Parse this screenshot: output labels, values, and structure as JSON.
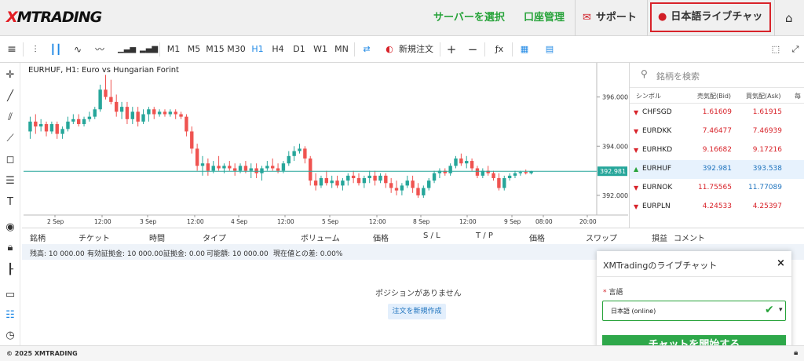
{
  "header": {
    "logo_prefix": "X",
    "logo_rest": "MTRADING",
    "nav_server": "サーバーを選択",
    "nav_account": "口座管理",
    "nav_support": "サポート",
    "nav_chat": "日本語ライブチャット",
    "icon_support": "envelope-icon",
    "icon_chat": "speech-bubble-icon",
    "icon_home": "home-icon",
    "accent": "#27a33a",
    "brand_red": "#d8232a"
  },
  "toolbar": {
    "timeframes": [
      "M1",
      "M5",
      "M15",
      "M30",
      "H1",
      "H4",
      "D1",
      "W1",
      "MN"
    ],
    "active_timeframe": "H1",
    "new_order": "新規注文"
  },
  "chart": {
    "title": "EURHUF, H1: Euro vs Hungarian Forint",
    "x_labels": [
      "2 Sep",
      "12:00",
      "3 Sep",
      "12:00",
      "4 Sep",
      "12:00",
      "5 Sep",
      "12:00",
      "8 Sep",
      "12:00",
      "9 Sep",
      "08:00",
      "20:00"
    ],
    "y_labels": [
      "396.000",
      "394.000",
      "392.000"
    ],
    "current_price": "392.981"
  },
  "chart_data": {
    "type": "candlestick",
    "symbol": "EURHUF",
    "timeframe": "H1",
    "ylim": [
      391.2,
      397.2
    ],
    "y_ticks": [
      396.0,
      394.0,
      392.0
    ],
    "current_price": 392.981,
    "up_color": "#26a69a",
    "down_color": "#ef5350",
    "series": [
      [
        394.6,
        395.2,
        394.3,
        395.0
      ],
      [
        395.0,
        395.3,
        394.5,
        394.8
      ],
      [
        394.8,
        395.1,
        394.6,
        394.9
      ],
      [
        394.9,
        395.0,
        394.4,
        394.6
      ],
      [
        394.6,
        395.0,
        394.5,
        394.9
      ],
      [
        394.9,
        395.0,
        394.3,
        394.5
      ],
      [
        394.5,
        394.8,
        394.3,
        394.7
      ],
      [
        394.7,
        395.2,
        394.6,
        395.0
      ],
      [
        395.0,
        395.3,
        394.9,
        395.1
      ],
      [
        395.1,
        395.3,
        394.8,
        394.9
      ],
      [
        394.9,
        395.2,
        394.8,
        395.1
      ],
      [
        395.1,
        395.4,
        395.0,
        395.2
      ],
      [
        395.2,
        395.6,
        395.1,
        395.5
      ],
      [
        395.5,
        396.5,
        395.4,
        396.3
      ],
      [
        396.3,
        396.9,
        395.9,
        396.0
      ],
      [
        396.0,
        396.7,
        395.7,
        395.8
      ],
      [
        395.8,
        396.1,
        395.2,
        395.4
      ],
      [
        395.4,
        395.8,
        395.1,
        395.6
      ],
      [
        395.6,
        395.8,
        394.9,
        395.1
      ],
      [
        395.1,
        395.6,
        394.9,
        395.4
      ],
      [
        395.4,
        395.6,
        394.8,
        395.0
      ],
      [
        395.0,
        395.5,
        394.9,
        395.3
      ],
      [
        395.3,
        395.6,
        395.0,
        395.5
      ],
      [
        395.5,
        395.6,
        395.1,
        395.3
      ],
      [
        395.3,
        395.5,
        395.2,
        395.4
      ],
      [
        395.4,
        395.5,
        395.2,
        395.3
      ],
      [
        395.3,
        395.5,
        395.2,
        395.4
      ],
      [
        395.4,
        395.5,
        395.1,
        395.3
      ],
      [
        395.3,
        395.4,
        395.1,
        395.2
      ],
      [
        395.2,
        395.3,
        394.4,
        394.6
      ],
      [
        394.6,
        394.8,
        393.7,
        393.9
      ],
      [
        393.9,
        394.1,
        393.0,
        393.2
      ],
      [
        393.2,
        393.6,
        392.8,
        393.3
      ],
      [
        393.3,
        393.5,
        392.8,
        393.0
      ],
      [
        393.0,
        393.4,
        392.9,
        393.2
      ],
      [
        393.2,
        393.6,
        393.0,
        393.1
      ],
      [
        393.1,
        393.3,
        392.9,
        393.2
      ],
      [
        393.2,
        393.4,
        393.0,
        393.1
      ],
      [
        393.1,
        393.3,
        392.8,
        393.0
      ],
      [
        393.0,
        393.3,
        392.9,
        393.2
      ],
      [
        393.2,
        393.4,
        392.9,
        393.0
      ],
      [
        393.0,
        393.3,
        392.7,
        393.1
      ],
      [
        393.1,
        393.3,
        392.7,
        392.9
      ],
      [
        392.9,
        393.2,
        392.6,
        393.1
      ],
      [
        393.1,
        393.4,
        393.0,
        393.2
      ],
      [
        393.2,
        393.5,
        393.0,
        393.1
      ],
      [
        393.1,
        393.3,
        392.9,
        393.0
      ],
      [
        393.0,
        393.4,
        392.9,
        393.3
      ],
      [
        393.3,
        393.8,
        393.2,
        393.6
      ],
      [
        393.6,
        394.0,
        393.4,
        393.8
      ],
      [
        393.8,
        394.1,
        393.7,
        393.9
      ],
      [
        393.9,
        394.0,
        393.3,
        393.5
      ],
      [
        393.5,
        393.6,
        392.4,
        392.6
      ],
      [
        392.6,
        392.9,
        392.2,
        392.4
      ],
      [
        392.4,
        392.8,
        392.3,
        392.7
      ],
      [
        392.7,
        393.0,
        392.4,
        392.5
      ],
      [
        392.5,
        392.8,
        392.3,
        392.6
      ],
      [
        392.6,
        392.8,
        392.3,
        392.4
      ],
      [
        392.4,
        392.7,
        392.2,
        392.6
      ],
      [
        392.6,
        392.9,
        392.4,
        392.8
      ],
      [
        392.8,
        393.0,
        392.5,
        392.7
      ],
      [
        392.7,
        392.9,
        392.4,
        392.5
      ],
      [
        392.5,
        392.8,
        392.3,
        392.7
      ],
      [
        392.7,
        393.0,
        392.5,
        392.8
      ],
      [
        392.8,
        393.0,
        392.4,
        392.6
      ],
      [
        392.6,
        392.9,
        392.5,
        392.8
      ],
      [
        392.8,
        392.9,
        392.3,
        392.5
      ],
      [
        392.5,
        392.7,
        392.1,
        392.3
      ],
      [
        392.3,
        392.6,
        392.0,
        392.2
      ],
      [
        392.2,
        392.5,
        392.0,
        392.4
      ],
      [
        392.4,
        392.8,
        392.3,
        392.6
      ],
      [
        392.6,
        392.8,
        392.1,
        392.3
      ],
      [
        392.3,
        392.5,
        391.9,
        392.0
      ],
      [
        392.0,
        392.4,
        391.9,
        392.3
      ],
      [
        392.3,
        392.7,
        392.2,
        392.6
      ],
      [
        392.6,
        393.0,
        392.5,
        392.9
      ],
      [
        392.9,
        393.1,
        392.7,
        393.0
      ],
      [
        393.0,
        393.1,
        392.8,
        392.9
      ],
      [
        392.9,
        393.3,
        392.8,
        393.2
      ],
      [
        393.2,
        393.6,
        393.1,
        393.5
      ],
      [
        393.5,
        393.7,
        393.2,
        393.3
      ],
      [
        393.3,
        393.6,
        393.1,
        393.4
      ],
      [
        393.4,
        393.5,
        393.0,
        393.1
      ],
      [
        393.1,
        393.2,
        392.7,
        392.8
      ],
      [
        392.8,
        393.1,
        392.7,
        393.0
      ],
      [
        393.0,
        393.2,
        392.8,
        392.9
      ],
      [
        392.9,
        393.0,
        392.6,
        392.7
      ],
      [
        392.7,
        392.9,
        392.2,
        392.3
      ],
      [
        392.3,
        392.8,
        392.2,
        392.7
      ],
      [
        392.7,
        392.9,
        392.6,
        392.8
      ],
      [
        392.8,
        393.0,
        392.7,
        392.9
      ],
      [
        392.9,
        393.0,
        392.8,
        392.95
      ],
      [
        392.95,
        393.05,
        392.85,
        392.9
      ],
      [
        392.9,
        393.0,
        392.85,
        392.981
      ]
    ]
  },
  "watchlist": {
    "search_placeholder": "銘柄を検索",
    "col_symbol": "シンボル",
    "col_bid": "売気配(Bid)",
    "col_ask": "買気配(Ask)",
    "col_extra": "毎",
    "rows": [
      {
        "symbol": "CHFSGD",
        "bid": "1.61609",
        "ask": "1.61915",
        "dir": "down"
      },
      {
        "symbol": "EURDKK",
        "bid": "7.46477",
        "ask": "7.46939",
        "dir": "down"
      },
      {
        "symbol": "EURHKD",
        "bid": "9.16682",
        "ask": "9.17216",
        "dir": "down"
      },
      {
        "symbol": "EURHUF",
        "bid": "392.981",
        "ask": "393.538",
        "dir": "up"
      },
      {
        "symbol": "EURNOK",
        "bid": "11.75565",
        "ask": "11.77089",
        "dir": "down"
      },
      {
        "symbol": "EURPLN",
        "bid": "4.24533",
        "ask": "4.25397",
        "dir": "down"
      }
    ]
  },
  "positions": {
    "headers": [
      "銘柄",
      "チケット",
      "時間",
      "タイプ",
      "ボリューム",
      "価格",
      "S / L",
      "T / P",
      "価格",
      "スワップ",
      "損益",
      "コメント"
    ],
    "summary": [
      "残高: 10 000.00",
      "有効証拠金: 10 000.00",
      "証拠金: 0.00",
      "可能額: 10 000.00",
      "現在値との差: 0.00%"
    ],
    "empty_text": "ポジションがありません",
    "new_order_button": "注文を新規作成"
  },
  "chat": {
    "title": "XMTradingのライブチャット",
    "close": "×",
    "language_label": "言語",
    "required_mark": "*",
    "language_value": "日本語 (online)",
    "start_button": "チャットを開始する"
  },
  "footer": {
    "copyright": "© 2025 XMTRADING",
    "icon_lock": "lock-icon"
  }
}
